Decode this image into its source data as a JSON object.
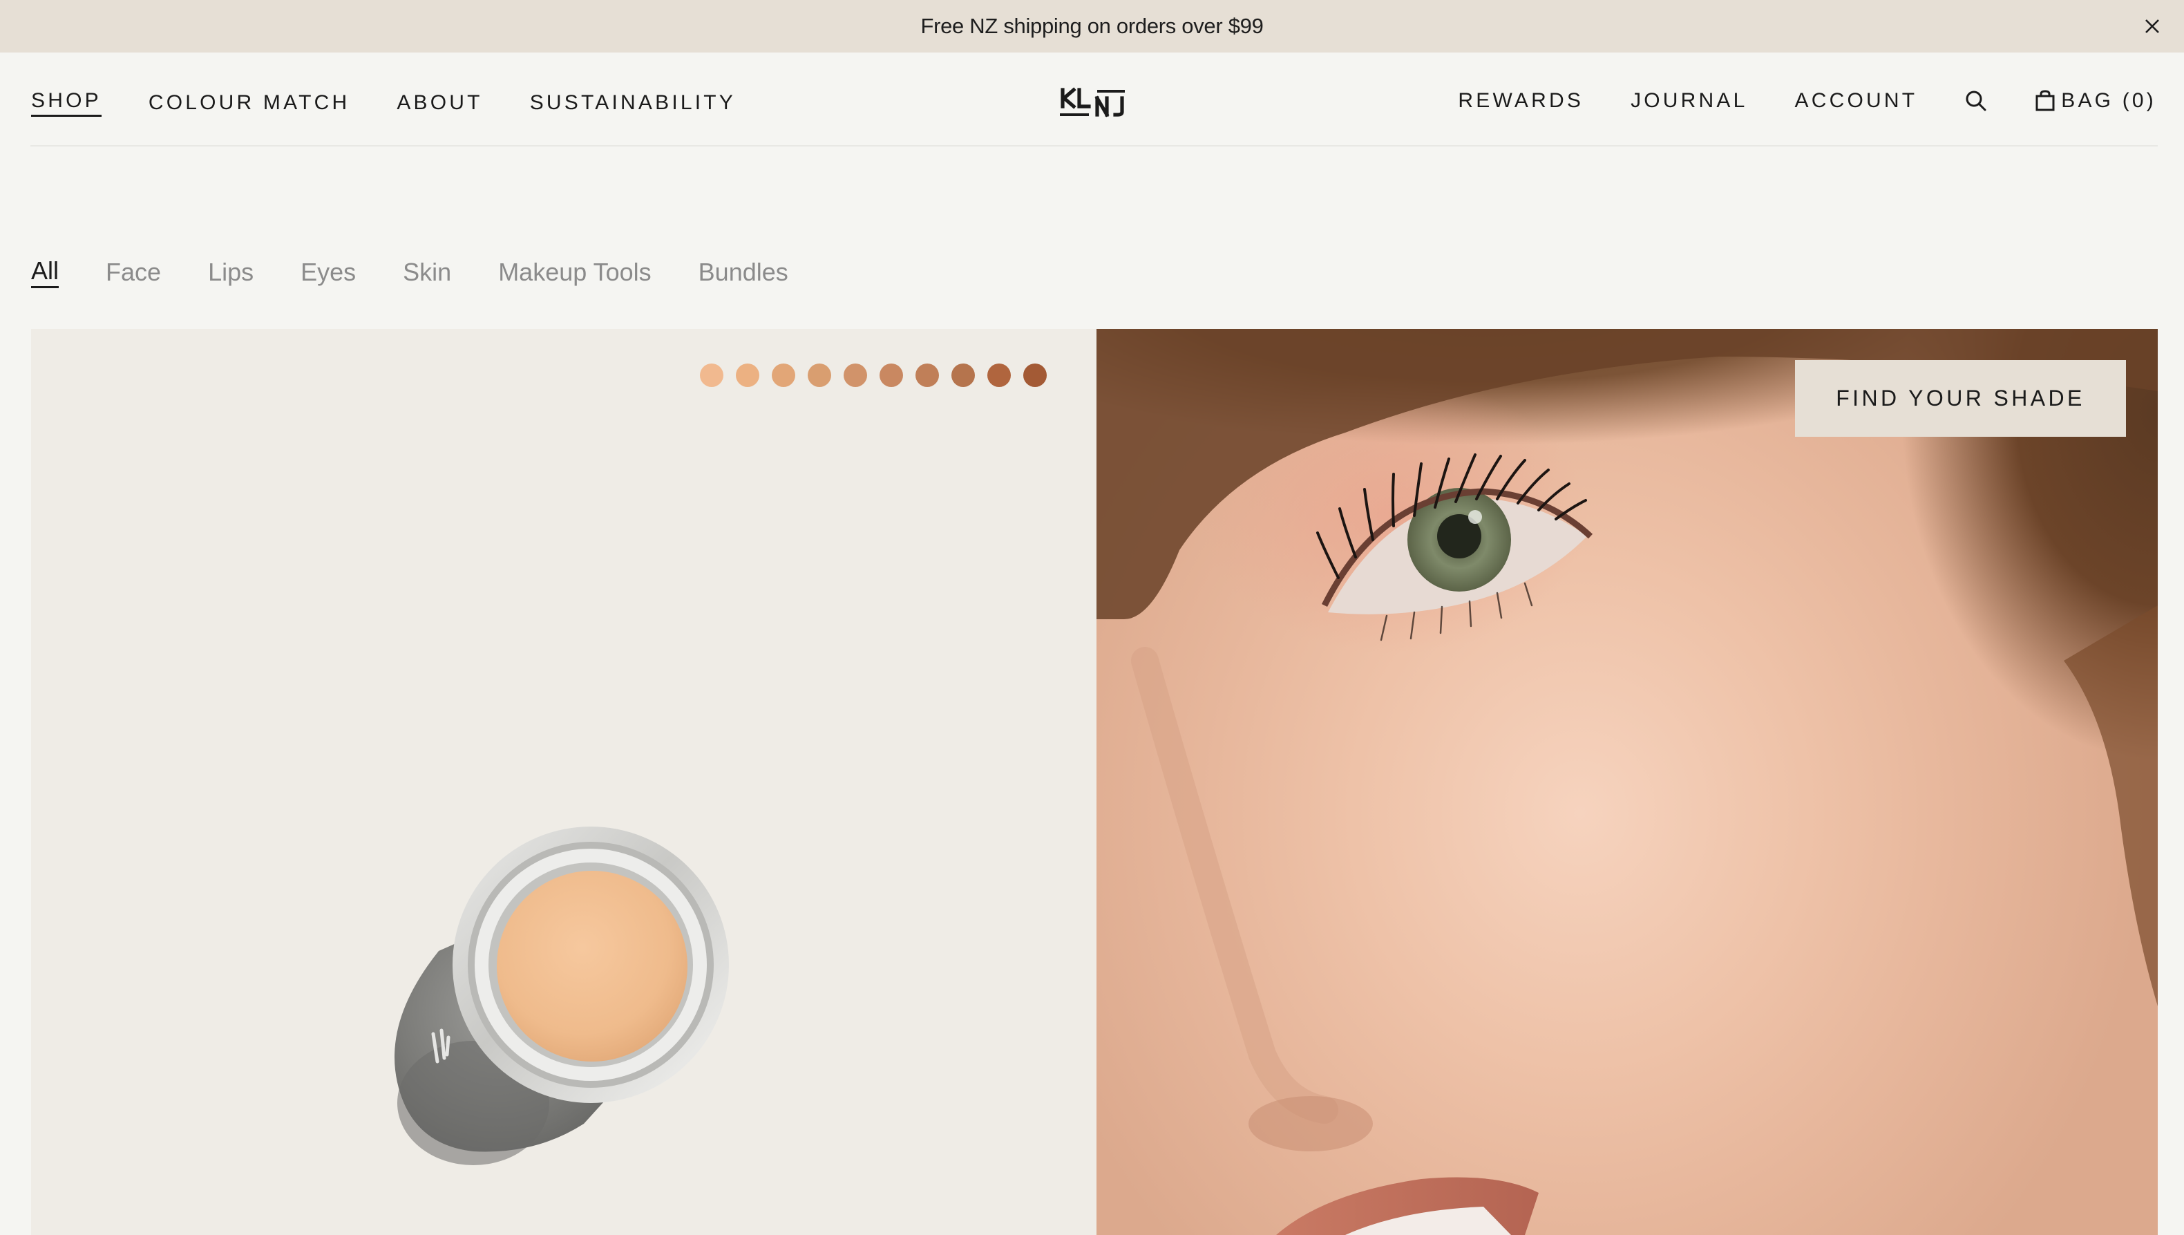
{
  "announcement": {
    "text": "Free NZ shipping on orders over $99",
    "close_icon": "close-icon"
  },
  "header": {
    "nav_left": [
      {
        "label": "SHOP",
        "active": true
      },
      {
        "label": "COLOUR MATCH",
        "active": false
      },
      {
        "label": "ABOUT",
        "active": false
      },
      {
        "label": "SUSTAINABILITY",
        "active": false
      }
    ],
    "logo_icon": "klnj-logo",
    "nav_right": [
      {
        "label": "REWARDS"
      },
      {
        "label": "JOURNAL"
      },
      {
        "label": "ACCOUNT"
      }
    ],
    "search_icon": "search-icon",
    "bag_icon": "shopping-bag-icon",
    "bag_label": "BAG (0)"
  },
  "categories": [
    {
      "label": "All",
      "active": true
    },
    {
      "label": "Face",
      "active": false
    },
    {
      "label": "Lips",
      "active": false
    },
    {
      "label": "Eyes",
      "active": false
    },
    {
      "label": "Skin",
      "active": false
    },
    {
      "label": "Makeup Tools",
      "active": false
    },
    {
      "label": "Bundles",
      "active": false
    }
  ],
  "product": {
    "swatch_colors": [
      "#f1b98f",
      "#ecb182",
      "#e2a677",
      "#d99e70",
      "#d1936a",
      "#c98861",
      "#c07f58",
      "#b5744d",
      "#b0653e",
      "#a35a35"
    ],
    "product_icon": "concealer-pot-image",
    "product_color": "#f2c094"
  },
  "model": {
    "image_icon": "model-closeup-image",
    "cta_label": "FIND YOUR SHADE"
  },
  "colors": {
    "background": "#f5f5f2",
    "announcement_bg": "#e6dfd5",
    "panel_bg": "#efece6",
    "text": "#1b1b1b",
    "muted_text": "#8b8b8b"
  }
}
